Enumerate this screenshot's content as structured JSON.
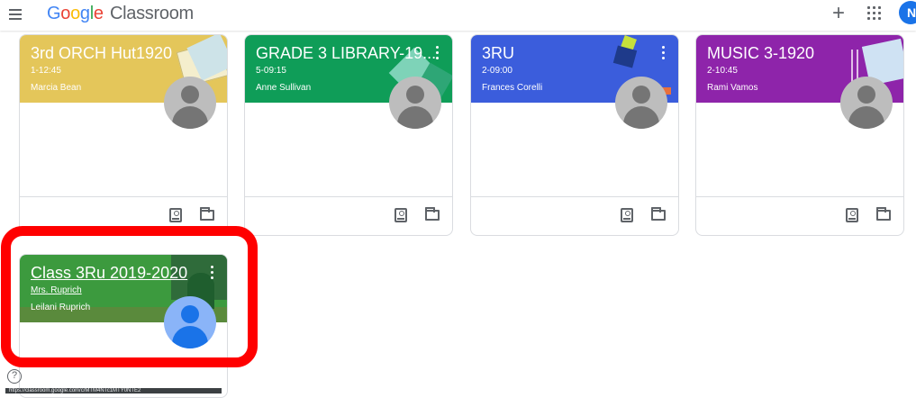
{
  "app": {
    "brand_letters": [
      "G",
      "o",
      "o",
      "g",
      "l",
      "e"
    ],
    "product": "Classroom",
    "user_initial": "N"
  },
  "colors": {
    "yellow": "#e4c65a",
    "green": "#0f9d58",
    "blue": "#3b5ddc",
    "purple": "#8e24aa",
    "class_green": "#3c9a3e",
    "highlight": "#ff0000"
  },
  "classes": [
    {
      "title": "3rd ORCH Hut1920",
      "section": "1-12:45",
      "teacher": "Marcia Bean"
    },
    {
      "title": "GRADE 3 LIBRARY-19...",
      "section": "5-09:15",
      "teacher": "Anne Sullivan"
    },
    {
      "title": "3RU",
      "section": "2-09:00",
      "teacher": "Frances Corelli"
    },
    {
      "title": "MUSIC 3-1920",
      "section": "2-10:45",
      "teacher": "Rami Vamos"
    },
    {
      "title": "Class 3Ru 2019-2020",
      "section": "Mrs. Ruprich",
      "teacher": "Leilani Ruprich"
    }
  ],
  "icons": {
    "menu": "menu-icon",
    "create": "plus-icon",
    "apps": "apps-grid-icon",
    "options": "more-vert-icon",
    "portfolio": "assignment-ind-icon",
    "folder": "folder-icon",
    "help": "help-icon"
  },
  "help_symbol": "?",
  "status_text": "https://classroom.google.com/c/MTM4NTc1MTY0NTE2"
}
